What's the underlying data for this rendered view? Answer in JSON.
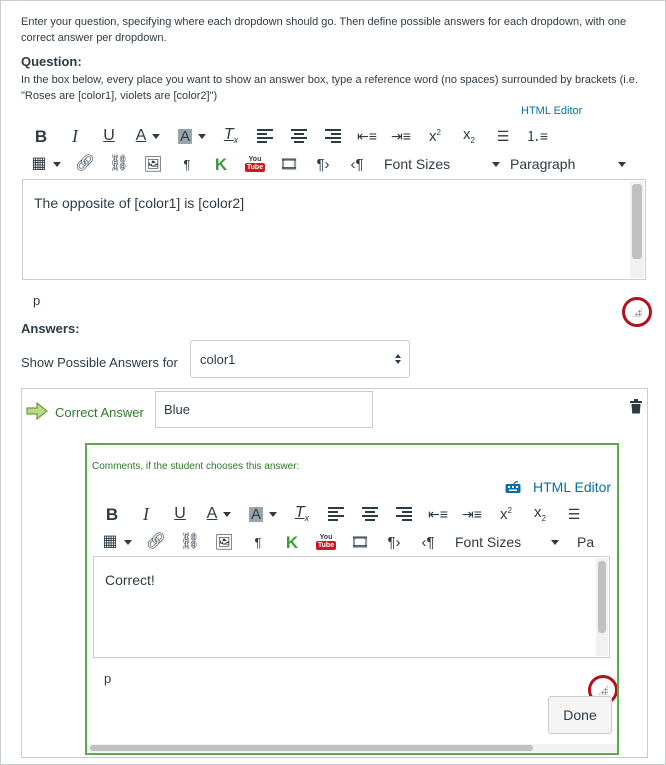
{
  "intro": {
    "text": "Enter your question, specifying where each dropdown should go. Then define possible answers for each dropdown, with one correct answer per dropdown."
  },
  "question": {
    "label": "Question:",
    "help": "In the box below, every place you want to show an answer box, type a reference word (no spaces) surrounded by brackets (i.e. \"Roses are [color1], violets are [color2]\")",
    "html_editor_label": "HTML Editor",
    "toolbar": {
      "font_sizes_label": "Font Sizes",
      "paragraph_label": "Paragraph",
      "icons": [
        "bold-icon",
        "italic-icon",
        "underline-icon",
        "text-color-icon",
        "background-color-icon",
        "clear-formatting-icon",
        "align-left-icon",
        "align-center-icon",
        "align-right-icon",
        "outdent-icon",
        "indent-icon",
        "superscript-icon",
        "subscript-icon",
        "bullet-list-icon",
        "numbered-list-icon",
        "table-icon",
        "link-icon",
        "unlink-icon",
        "image-icon",
        "pilcrow-icon",
        "kaltura-icon",
        "youtube-icon",
        "media-icon",
        "ltr-icon",
        "rtl-icon"
      ]
    },
    "content": "The opposite of [color1] is [color2]",
    "path": "p"
  },
  "answers": {
    "label": "Answers:",
    "show_for_label": "Show Possible Answers for",
    "show_for_value": "color1",
    "correct_answer_label": "Correct Answer",
    "answer_value": "Blue",
    "comments": {
      "label": "Comments, if the student chooses this answer:",
      "html_editor_label": "HTML Editor",
      "font_sizes_label": "Font Sizes",
      "paragraph_label": "Pa",
      "content": "Correct!",
      "path": "p",
      "done_label": "Done"
    }
  },
  "colors": {
    "text": "#2d3b45",
    "link": "#0770a3",
    "green": "#2b7b25",
    "green_border": "#5ca84c",
    "callout_red": "#b3111b",
    "youtube_red": "#cc181e",
    "kaltura_green": "#3e9a3a"
  }
}
